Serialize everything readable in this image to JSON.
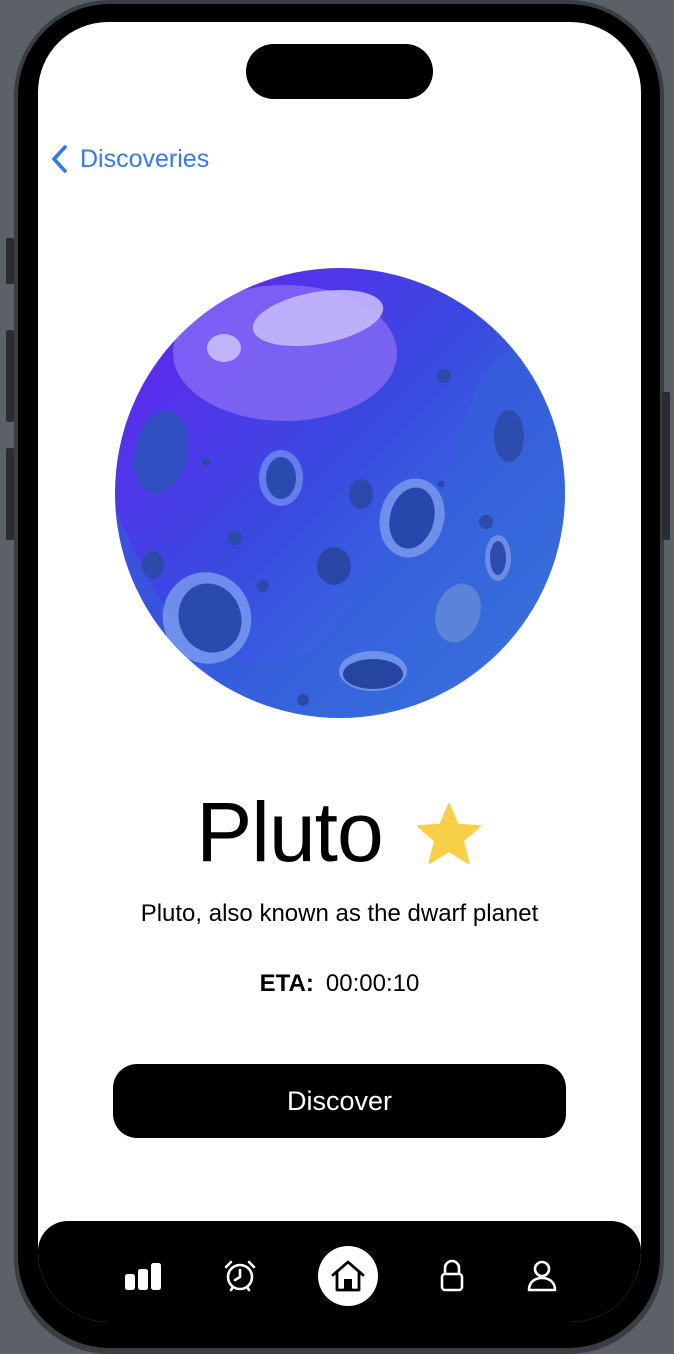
{
  "nav": {
    "back_label": "Discoveries"
  },
  "planet": {
    "name": "Pluto",
    "description": "Pluto, also known as the dwarf planet",
    "favorite": true
  },
  "eta": {
    "label": "ETA:",
    "value": "00:00:10"
  },
  "actions": {
    "discover_label": "Discover"
  },
  "tabbar": {
    "items": [
      {
        "name": "stats",
        "icon": "bar-chart-icon",
        "active": false
      },
      {
        "name": "alarm",
        "icon": "alarm-clock-icon",
        "active": false
      },
      {
        "name": "home",
        "icon": "home-icon",
        "active": true
      },
      {
        "name": "lock",
        "icon": "lock-icon",
        "active": false
      },
      {
        "name": "profile",
        "icon": "user-icon",
        "active": false
      }
    ]
  },
  "colors": {
    "link": "#3478f6",
    "star": "#f8d047",
    "planet_primary": "#3a55e0",
    "button_bg": "#000000"
  }
}
